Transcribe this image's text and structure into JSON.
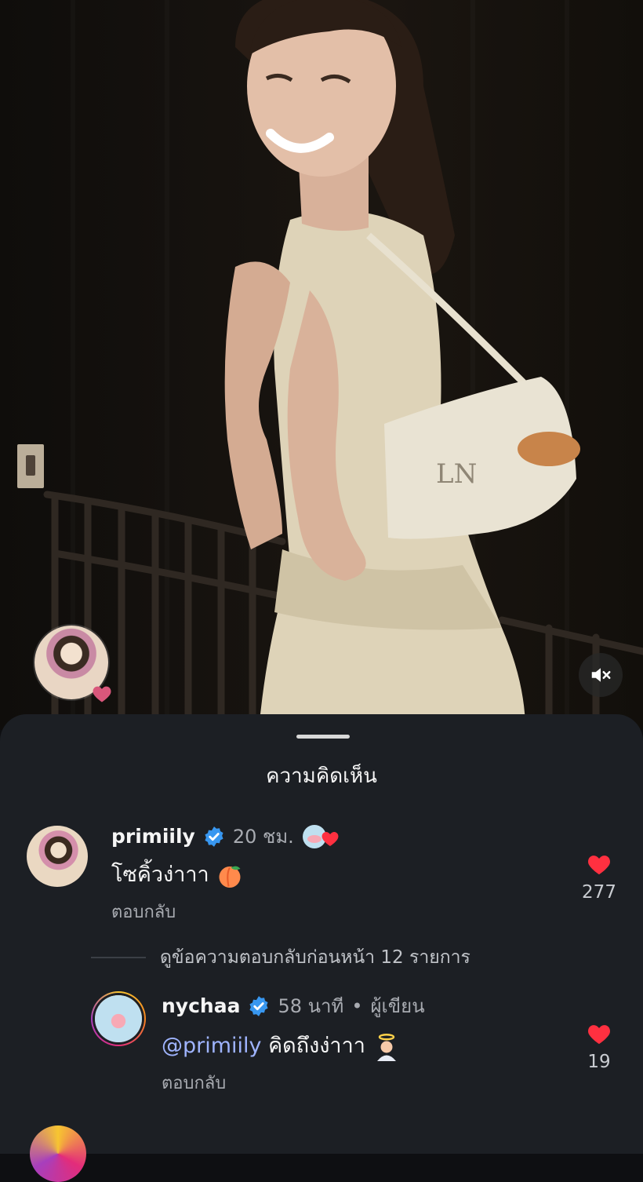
{
  "sheet": {
    "title": "ความคิดเห็น"
  },
  "comments": [
    {
      "username": "primiily",
      "time": "20 ชม.",
      "text": "โซคิ้วง่าาา",
      "reply_label": "ตอบกลับ",
      "likes": "277"
    }
  ],
  "view_replies": "ดูข้อความตอบกลับก่อนหน้า 12 รายการ",
  "replies": [
    {
      "username": "nychaa",
      "time": "58 นาที",
      "role": "ผู้เขียน",
      "mention": "@primiily",
      "text": "คิดถึงง่าาา",
      "reply_label": "ตอบกลับ",
      "likes": "19"
    }
  ],
  "colors": {
    "like": "#ff3040",
    "verified": "#3897f0",
    "sheet_bg": "#1c1f24"
  },
  "icons": [
    "heart-icon",
    "verified-badge-icon",
    "mute-icon",
    "peach-emoji",
    "angel-emoji"
  ]
}
